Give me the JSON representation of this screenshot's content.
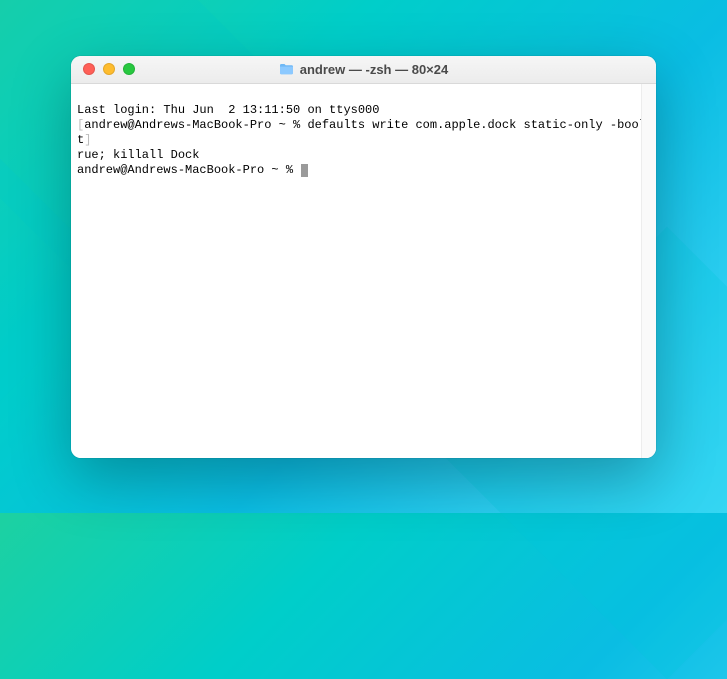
{
  "titlebar": {
    "title": "andrew — -zsh — 80×24",
    "icon": "home-folder-icon"
  },
  "terminal": {
    "last_login": "Last login: Thu Jun  2 13:11:50 on ttys000",
    "line1_left_bracket": "[",
    "line1_prompt": "andrew@Andrews-MacBook-Pro ~ % ",
    "line1_command_part1": "defaults write com.apple.dock static-only -bool t",
    "line1_right_bracket": "]",
    "line2_command_part2": "rue; killall Dock",
    "line3_prompt": "andrew@Andrews-MacBook-Pro ~ % "
  }
}
